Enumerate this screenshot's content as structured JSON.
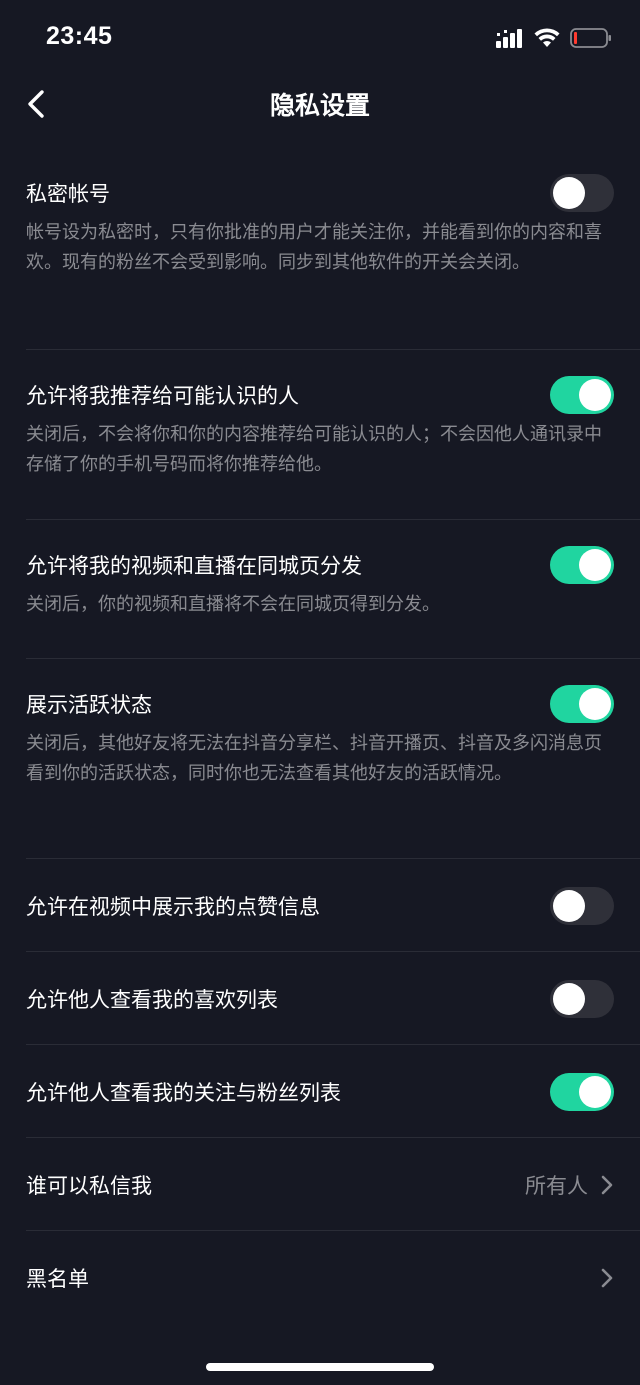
{
  "status_bar": {
    "time": "23:45"
  },
  "nav": {
    "title": "隐私设置"
  },
  "colors": {
    "background": "#161823",
    "toggle_on": "#20d5a0",
    "toggle_off": "#2f3039",
    "secondary_text": "#8a8b91",
    "battery_low": "#ff3b30"
  },
  "settings": [
    {
      "label": "私密帐号",
      "desc": "帐号设为私密时，只有你批准的用户才能关注你，并能看到你的内容和喜欢。现有的粉丝不会受到影响。同步到其他软件的开关会关闭。",
      "toggle": "off"
    },
    {
      "label": "允许将我推荐给可能认识的人",
      "desc": "关闭后，不会将你和你的内容推荐给可能认识的人；不会因他人通讯录中存储了你的手机号码而将你推荐给他。",
      "toggle": "on"
    },
    {
      "label": "允许将我的视频和直播在同城页分发",
      "desc": "关闭后，你的视频和直播将不会在同城页得到分发。",
      "toggle": "on"
    },
    {
      "label": "展示活跃状态",
      "desc": "关闭后，其他好友将无法在抖音分享栏、抖音开播页、抖音及多闪消息页看到你的活跃状态，同时你也无法查看其他好友的活跃情况。",
      "toggle": "on"
    },
    {
      "label": "允许在视频中展示我的点赞信息",
      "toggle": "off"
    },
    {
      "label": "允许他人查看我的喜欢列表",
      "toggle": "off"
    },
    {
      "label": "允许他人查看我的关注与粉丝列表",
      "toggle": "on"
    },
    {
      "label": "谁可以私信我",
      "value": "所有人"
    },
    {
      "label": "黑名单"
    }
  ]
}
